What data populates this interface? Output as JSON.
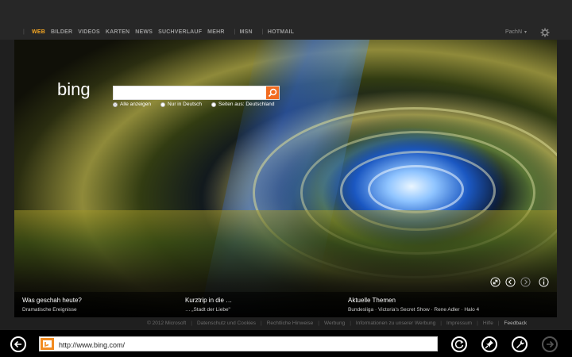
{
  "nav": {
    "items": [
      "WEB",
      "BILDER",
      "VIDEOS",
      "KARTEN",
      "NEWS",
      "SUCHVERLAUF",
      "MEHR"
    ],
    "msn": "MSN",
    "hotmail": "HOTMAIL",
    "user": "PachN",
    "icons": [
      "settings-gear-icon"
    ]
  },
  "search": {
    "logo": "bing",
    "value": "",
    "options": [
      "Alle anzeigen",
      "Nur in Deutsch",
      "Seiten aus: Deutschland"
    ],
    "selected_option": "Alle anzeigen"
  },
  "hotspots": [
    {
      "title": "Was geschah heute?",
      "subtitle": "Dramatische Ereignisse"
    },
    {
      "title": "Kurztrip in die …",
      "subtitle": "… „Stadt der Liebe\""
    },
    {
      "title": "Aktuelle Themen",
      "subtitle": "Bundesliga · Victoria's Secret Show · Rene Adler · Halo 4"
    }
  ],
  "footer": {
    "links": [
      "© 2012 Microsoft",
      "Datenschutz und Cookies",
      "Rechtliche Hinweise",
      "Werbung",
      "Informationen zu unserer Werbung",
      "Impressum",
      "Hilfe"
    ],
    "feedback": "Feedback"
  },
  "browser": {
    "url": "http://www.bing.com/"
  },
  "colors": {
    "accent": "#f5a623",
    "search_button": "#f26c21",
    "favicon": "#f28b20"
  }
}
